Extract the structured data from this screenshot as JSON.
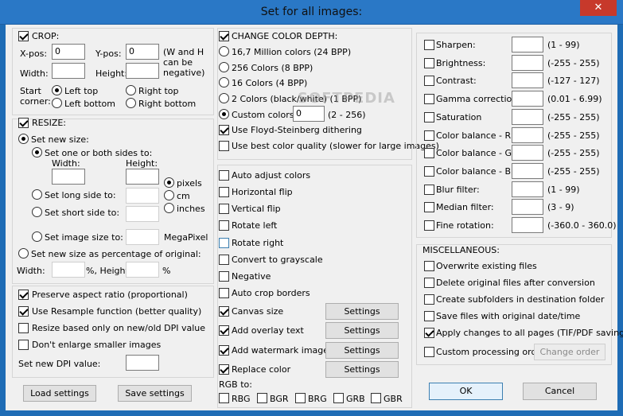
{
  "window": {
    "title": "Set for all images:",
    "close_glyph": "✕"
  },
  "crop": {
    "label": "CROP:",
    "xpos_label": "X-pos:",
    "xpos_value": "0",
    "ypos_label": "Y-pos:",
    "ypos_value": "0",
    "hint": "(W and H can be negative)",
    "width_label": "Width:",
    "height_label": "Height:",
    "start_corner_label": "Start corner:",
    "left_top": "Left top",
    "right_top": "Right top",
    "left_bottom": "Left bottom",
    "right_bottom": "Right bottom"
  },
  "resize": {
    "label": "RESIZE:",
    "set_new_size": "Set new size:",
    "set_one_or_both": "Set one or both sides to:",
    "width_label": "Width:",
    "height_label": "Height:",
    "pixels": "pixels",
    "cm": "cm",
    "inches": "inches",
    "set_long_side": "Set long side to:",
    "set_short_side": "Set short side to:",
    "set_image_size": "Set image size to:",
    "megapixel": "MegaPixel",
    "percentage": "Set new size as percentage of original:",
    "pct_width": "Width:",
    "pct_mid": "%, Height:",
    "pct_end": "%"
  },
  "options": {
    "preserve_aspect": "Preserve aspect ratio (proportional)",
    "use_resample": "Use Resample function (better quality)",
    "resize_dpi": "Resize based only on new/old DPI value",
    "dont_enlarge": "Don't enlarge smaller images",
    "set_dpi": "Set new DPI value:"
  },
  "buttons": {
    "load_settings": "Load settings",
    "save_settings": "Save settings",
    "settings": "Settings",
    "ok": "OK",
    "cancel": "Cancel",
    "change_order": "Change order"
  },
  "color_depth": {
    "label": "CHANGE COLOR DEPTH:",
    "opt_24": "16,7 Million colors (24 BPP)",
    "opt_8": "256 Colors (8 BPP)",
    "opt_4": "16 Colors (4 BPP)",
    "opt_1": "2 Colors (black/white) (1 BPP)",
    "custom": "Custom colors:",
    "custom_value": "0",
    "custom_range": "(2 - 256)",
    "floyd": "Use Floyd-Steinberg dithering",
    "best_quality": "Use best color quality (slower for large images)"
  },
  "transforms": {
    "auto_adjust": "Auto adjust colors",
    "hflip": "Horizontal flip",
    "vflip": "Vertical flip",
    "rot_left": "Rotate left",
    "rot_right": "Rotate right",
    "grayscale": "Convert to grayscale",
    "negative": "Negative",
    "auto_crop": "Auto crop borders",
    "canvas": "Canvas size",
    "overlay_text": "Add overlay text",
    "watermark": "Add watermark image",
    "replace_color": "Replace color",
    "rgb_to": "RGB to:",
    "rgbs": [
      "RBG",
      "BGR",
      "BRG",
      "GRB",
      "GBR"
    ]
  },
  "adjust": {
    "items": [
      {
        "label": "Sharpen:",
        "range": "(1  -  99)"
      },
      {
        "label": "Brightness:",
        "range": "(-255  -  255)"
      },
      {
        "label": "Contrast:",
        "range": "(-127  -  127)"
      },
      {
        "label": "Gamma correction:",
        "range": "(0.01  -  6.99)"
      },
      {
        "label": "Saturation",
        "range": "(-255  -  255)"
      },
      {
        "label": "Color balance - R:",
        "range": "(-255  -  255)"
      },
      {
        "label": "Color balance - G:",
        "range": "(-255  -  255)"
      },
      {
        "label": "Color balance - B:",
        "range": "(-255  -  255)"
      },
      {
        "label": "Blur filter:",
        "range": "(1  -  99)"
      },
      {
        "label": "Median filter:",
        "range": "(3  -  9)"
      },
      {
        "label": "Fine rotation:",
        "range": "(-360.0  -  360.0)"
      }
    ]
  },
  "misc": {
    "label": "MISCELLANEOUS:",
    "overwrite": "Overwrite existing files",
    "delete_orig": "Delete original files after conversion",
    "subfolders": "Create subfolders in destination folder",
    "orig_date": "Save files with original date/time",
    "apply_pages": "Apply changes to all pages (TIF/PDF saving)",
    "custom_order": "Custom processing order"
  },
  "watermark_text": "SOFTPEDIA"
}
